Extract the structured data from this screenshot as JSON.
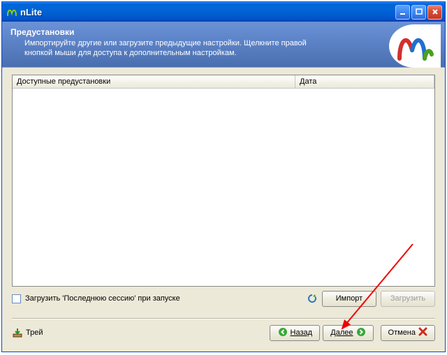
{
  "window": {
    "title": "nLite"
  },
  "header": {
    "title": "Предустановки",
    "description": "Импортируйте другие или загрузите предыдущие настройки. Щелкните правой кнопкой мыши для доступа к дополнительным настройкам."
  },
  "listview": {
    "columns": {
      "presets": "Доступные предустановки",
      "date": "Дата"
    }
  },
  "options": {
    "load_last_session_label": "Загрузить 'Последнюю сессию' при запуске",
    "import_label": "Импорт",
    "load_label": "Загрузить"
  },
  "footer": {
    "tray_label": "Трей",
    "back_label": "Назад",
    "next_label": "Далее",
    "cancel_label": "Отмена"
  }
}
